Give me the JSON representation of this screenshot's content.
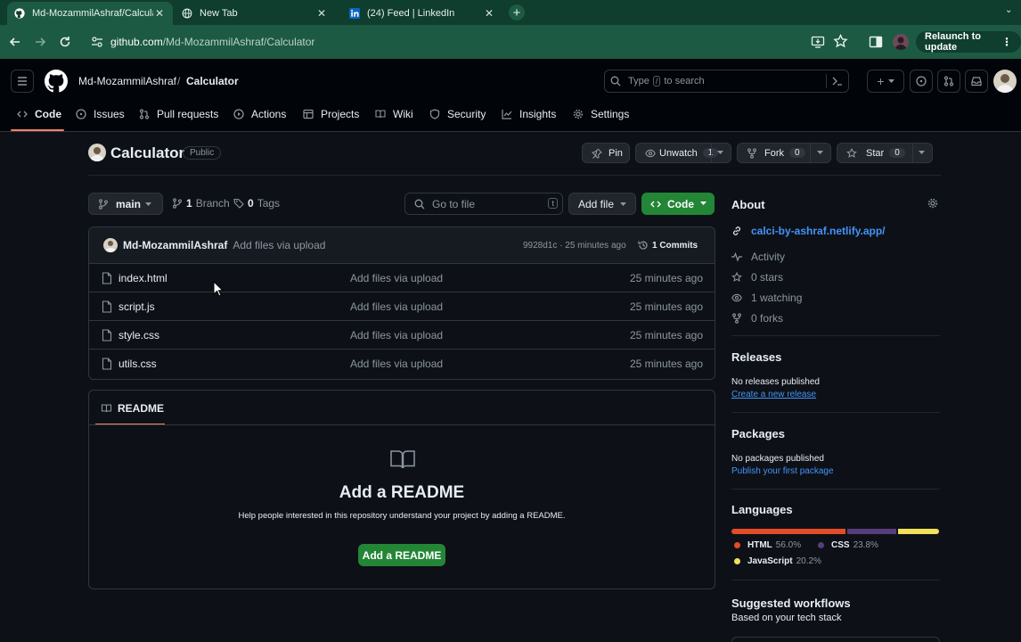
{
  "browser": {
    "tabs": [
      {
        "title": "Md-MozammilAshraf/Calcula",
        "active": true,
        "icon": "github-icon"
      },
      {
        "title": "New Tab",
        "active": false,
        "icon": "globe-icon"
      },
      {
        "title": "(24) Feed | LinkedIn",
        "active": false,
        "icon": "linkedin-icon"
      }
    ],
    "new_tab_label": "+",
    "url": "github.com/Md-MozammilAshraf/Calculator",
    "url_host": "github.com",
    "url_path": "/Md-MozammilAshraf/Calculator",
    "relaunch_label": "Relaunch to update"
  },
  "header": {
    "owner": "Md-MozammilAshraf",
    "separator": "/",
    "repo": "Calculator",
    "search_placeholder_pre": "Type",
    "search_key": "/",
    "search_placeholder_post": "to search",
    "plus_label": "+"
  },
  "nav": {
    "tabs": [
      {
        "label": "Code",
        "icon": "code-icon",
        "active": true
      },
      {
        "label": "Issues",
        "icon": "issue-icon"
      },
      {
        "label": "Pull requests",
        "icon": "pull-request-icon"
      },
      {
        "label": "Actions",
        "icon": "play-icon"
      },
      {
        "label": "Projects",
        "icon": "table-icon"
      },
      {
        "label": "Wiki",
        "icon": "book-icon"
      },
      {
        "label": "Security",
        "icon": "shield-icon"
      },
      {
        "label": "Insights",
        "icon": "graph-icon"
      },
      {
        "label": "Settings",
        "icon": "gear-icon"
      }
    ]
  },
  "repo": {
    "name": "Calculator",
    "visibility": "Public",
    "pin_label": "Pin",
    "unwatch_label": "Unwatch",
    "unwatch_count": "1",
    "fork_label": "Fork",
    "fork_count": "0",
    "star_label": "Star",
    "star_count": "0"
  },
  "filebar": {
    "branch": "main",
    "branch_count": "1",
    "branch_label": "Branch",
    "tag_count": "0",
    "tag_label": "Tags",
    "goto_placeholder": "Go to file",
    "goto_key": "t",
    "add_file_label": "Add file",
    "code_label": "Code"
  },
  "commit": {
    "author": "Md-MozammilAshraf",
    "message": "Add files via upload",
    "hash_time": "9928d1c · 25 minutes ago",
    "commits_label": "1 Commits"
  },
  "files": [
    {
      "name": "index.html",
      "message": "Add files via upload",
      "time": "25 minutes ago"
    },
    {
      "name": "script.js",
      "message": "Add files via upload",
      "time": "25 minutes ago"
    },
    {
      "name": "style.css",
      "message": "Add files via upload",
      "time": "25 minutes ago"
    },
    {
      "name": "utils.css",
      "message": "Add files via upload",
      "time": "25 minutes ago"
    }
  ],
  "readme": {
    "tab_label": "README",
    "title": "Add a README",
    "description": "Help people interested in this repository understand your project by adding a README.",
    "button_label": "Add a README"
  },
  "about": {
    "title": "About",
    "link": "calci-by-ashraf.netlify.app/",
    "activity": "Activity",
    "stars": "0 stars",
    "watching": "1 watching",
    "forks": "0 forks"
  },
  "releases": {
    "title": "Releases",
    "empty": "No releases published",
    "create_link": "Create a new release"
  },
  "packages": {
    "title": "Packages",
    "empty": "No packages published",
    "publish_link": "Publish your first package"
  },
  "languages": {
    "title": "Languages",
    "items": [
      {
        "name": "HTML",
        "percent": "56.0%",
        "value": 56.0,
        "color": "#e34c26"
      },
      {
        "name": "CSS",
        "percent": "23.8%",
        "value": 23.8,
        "color": "#563d7c"
      },
      {
        "name": "JavaScript",
        "percent": "20.2%",
        "value": 20.2,
        "color": "#f1e05a"
      }
    ]
  },
  "workflows": {
    "title": "Suggested workflows",
    "subtitle": "Based on your tech stack"
  },
  "colors": {
    "accent_green": "#238636",
    "link_blue": "#4493f8",
    "nav_underline": "#f78166"
  }
}
